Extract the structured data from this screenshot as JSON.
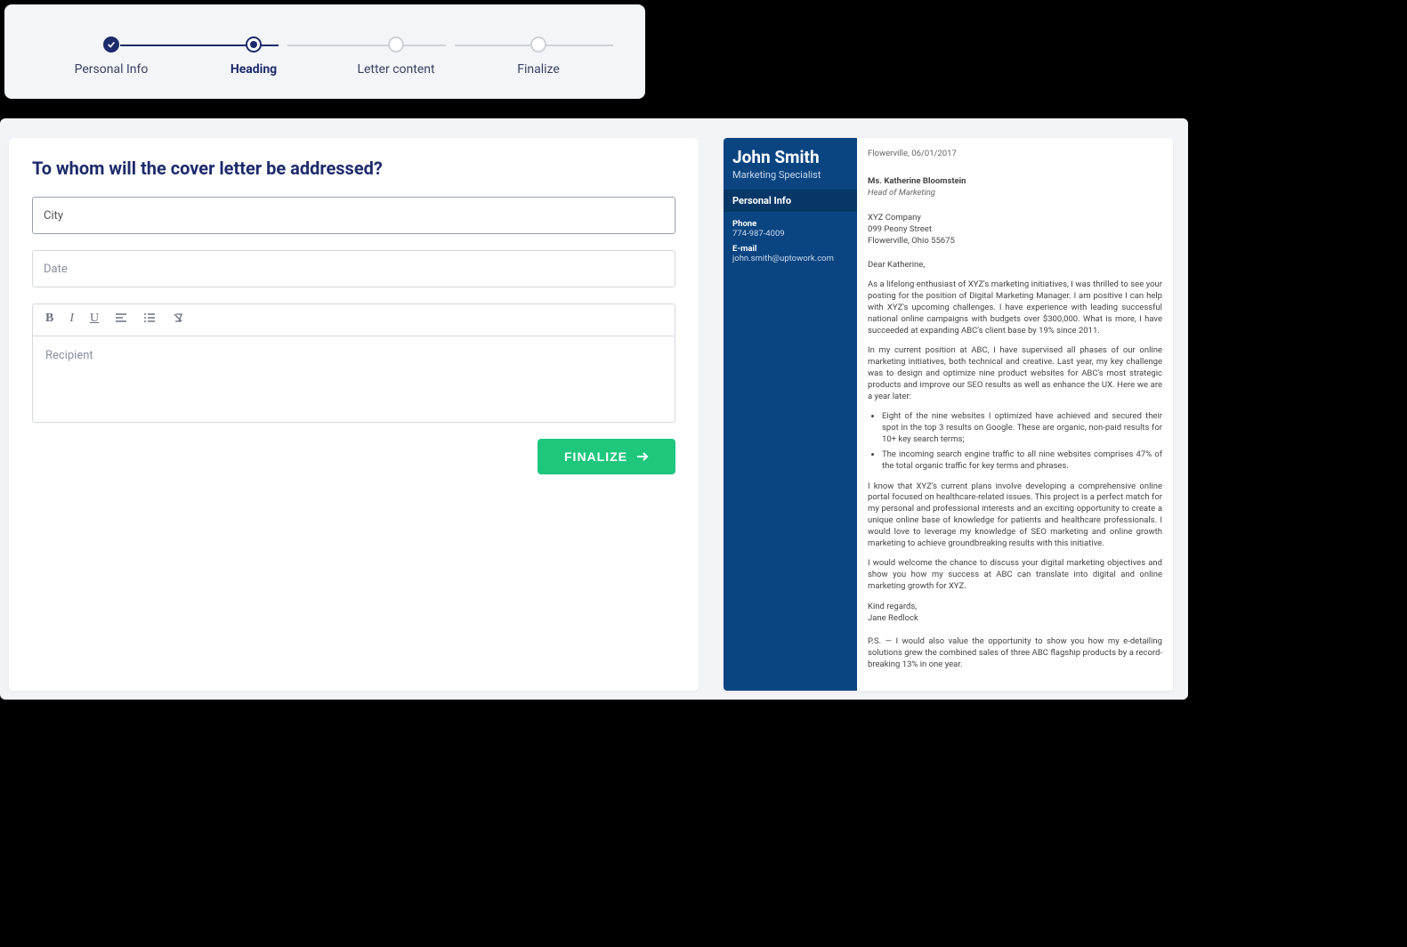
{
  "stepper": {
    "steps": [
      {
        "label": "Personal Info",
        "state": "completed"
      },
      {
        "label": "Heading",
        "state": "active"
      },
      {
        "label": "Letter content",
        "state": "pending"
      },
      {
        "label": "Finalize",
        "state": "pending"
      }
    ]
  },
  "form": {
    "title": "To whom will the cover letter be addressed?",
    "city_placeholder": "City",
    "date_placeholder": "Date",
    "recipient_placeholder": "Recipient",
    "finalize_label": "FINALIZE"
  },
  "toolbar": {
    "bold": "B",
    "italic": "I",
    "underline": "U"
  },
  "preview": {
    "name": "John Smith",
    "title": "Marketing Specialist",
    "personal_info_header": "Personal Info",
    "phone_label": "Phone",
    "phone": "774-987-4009",
    "email_label": "E-mail",
    "email": "john.smith@uptowork.com",
    "date_line": "Flowerville, 06/01/2017",
    "recipient_name": "Ms. Katherine Bloomstein",
    "recipient_title": "Head of Marketing",
    "company": "XYZ Company",
    "addr1": "099 Peony Street",
    "addr2": "Flowerville, Ohio 55675",
    "salutation": "Dear Katherine,",
    "p1": "As a lifelong enthusiast of XYZ's marketing initiatives, I was thrilled to see your posting for the position of Digital Marketing Manager. I am positive I can help with XYZ's upcoming challenges. I have experience with leading successful national online campaigns with budgets over $300,000. What is more, I have succeeded at expanding ABC's client base by 19% since 2011.",
    "p2": "In my current position at ABC, I have supervised all phases of our online marketing initiatives, both technical and creative. Last year, my key challenge was to design and optimize nine product websites for ABC's most strategic products and improve our SEO results as well as enhance the UX. Here we are a year later:",
    "li1": "Eight of the nine websites I optimized have achieved and secured their spot in the top 3 results on Google. These are organic, non-paid results for 10+ key search terms;",
    "li2": "The incoming search engine traffic to all nine websites comprises 47% of the total organic traffic for key terms and phrases.",
    "p3": "I know that XYZ's current plans involve developing a comprehensive online portal focused on healthcare-related issues. This project is a perfect match for my personal and professional interests and an exciting opportunity to create a unique online base of knowledge for patients and healthcare professionals. I would love to leverage my knowledge of SEO marketing and online growth marketing to achieve groundbreaking results with this initiative.",
    "p4": "I would welcome the chance to discuss your digital marketing objectives and show you how my success at ABC can translate into digital and online marketing growth for XYZ.",
    "closing": "Kind regards,",
    "signature": "Jane Redlock",
    "ps": "P.S. — I would also value the opportunity to show you how my e-detailing solutions grew the combined sales of three ABC flagship products by a record-breaking 13% in one year."
  }
}
